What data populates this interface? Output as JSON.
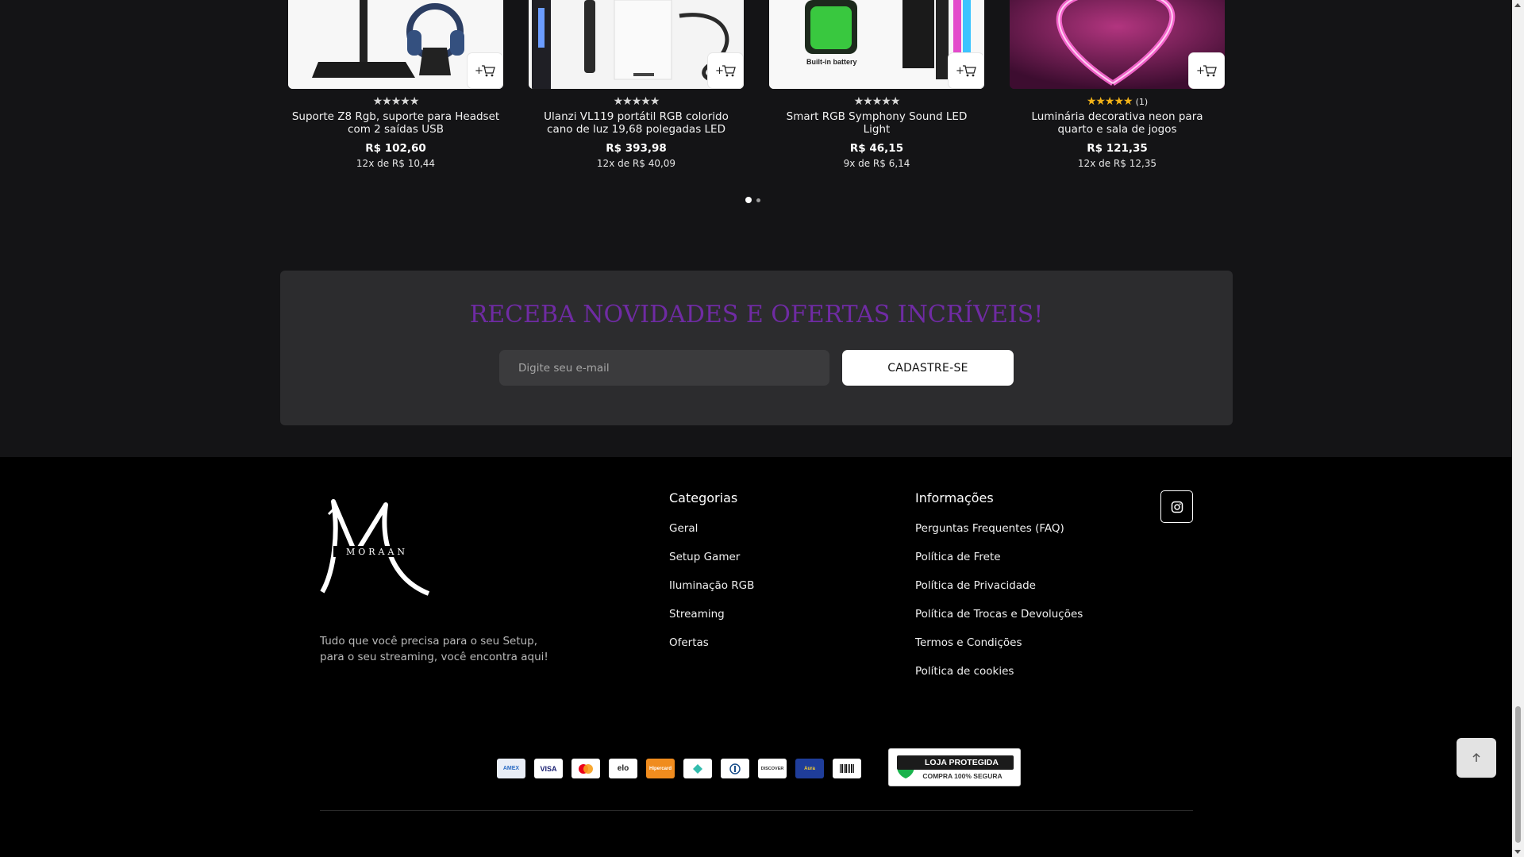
{
  "products": [
    {
      "name": "Suporte Z8 Rgb, suporte para Headset com 2 saídas USB",
      "rating": "★★★★★",
      "review_count": "",
      "price": "R$ 102,60",
      "installments": "12x de R$ 10,44",
      "rated": false
    },
    {
      "name": "Ulanzi VL119 portátil RGB colorido cano de luz 19,68 polegadas LED",
      "rating": "★★★★★",
      "review_count": "",
      "price": "R$ 393,98",
      "installments": "12x de R$ 40,09",
      "rated": false
    },
    {
      "name": "Smart RGB Symphony Sound LED Light",
      "rating": "★★★★★",
      "review_count": "",
      "price": "R$ 46,15",
      "installments": "9x de R$ 6,14",
      "rated": false,
      "image_caption": "Built-in battery"
    },
    {
      "name": "Luminária decorativa neon para quarto e sala de jogos",
      "rating": "★★★★★",
      "review_count": "(1)",
      "price": "R$ 121,35",
      "installments": "12x de R$ 12,35",
      "rated": true
    }
  ],
  "carousel": {
    "active_page": 1,
    "pages": 2
  },
  "newsletter": {
    "title": "RECEBA NOVIDADES E OFERTAS INCRÍVEIS!",
    "email_placeholder": "Digite seu e-mail",
    "submit_label": "CADASTRE-SE",
    "title_color": "#6f2ba3"
  },
  "footer": {
    "logo_text": "MORAAN",
    "tagline": "Tudo que você precisa para o seu Setup, para o seu streaming, você encontra aqui!",
    "categories": {
      "heading": "Categorias",
      "links": [
        "Geral",
        "Setup Gamer",
        "Iluminação RGB",
        "Streaming",
        "Ofertas"
      ]
    },
    "info": {
      "heading": "Informações",
      "links": [
        "Perguntas Frequentes (FAQ)",
        "Política de Frete",
        "Política de Privacidade",
        "Política de Trocas e Devoluções",
        "Termos e Condições",
        "Política de cookies"
      ]
    },
    "social_icon": "instagram-icon",
    "payment_methods": [
      "AMEX",
      "VISA",
      "mastercard",
      "elo",
      "Hipercard",
      "Pix",
      "Diners",
      "DISCOVER",
      "Aura",
      "boleto"
    ],
    "seal": {
      "top": "LOJA PROTEGIDA",
      "bottom": "COMPRA 100% SEGURA"
    }
  },
  "icons": {
    "cart": "add-to-cart-icon",
    "back_to_top": "arrow-up-icon"
  }
}
